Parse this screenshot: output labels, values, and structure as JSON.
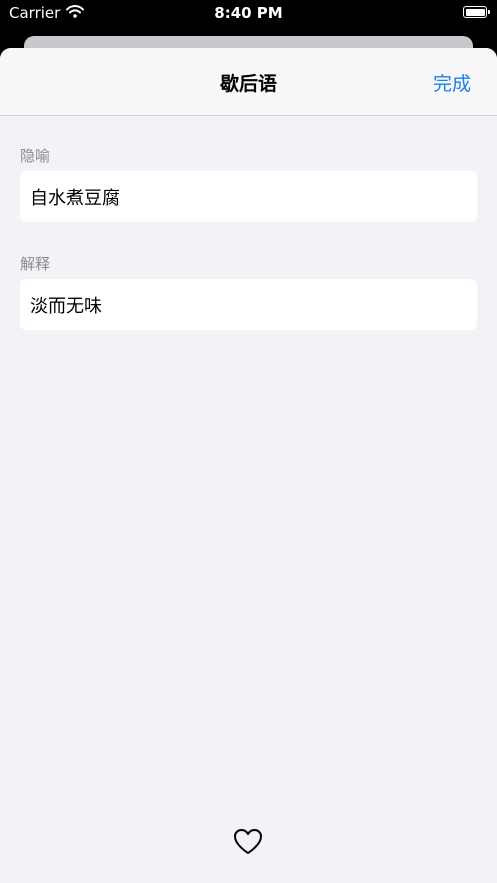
{
  "status_bar": {
    "carrier": "Carrier",
    "time": "8:40 PM",
    "battery_level": 1.0
  },
  "nav": {
    "title": "歇后语",
    "done_label": "完成"
  },
  "sections": [
    {
      "label": "隐喻",
      "value": "自水煮豆腐"
    },
    {
      "label": "解释",
      "value": "淡而无味"
    }
  ],
  "icons": {
    "favorite": "heart-outline-icon",
    "wifi": "wifi-icon",
    "battery": "battery-icon"
  },
  "colors": {
    "accent": "#1a7fe8",
    "background": "#f2f2f7",
    "label_gray": "#8a8a8e"
  }
}
